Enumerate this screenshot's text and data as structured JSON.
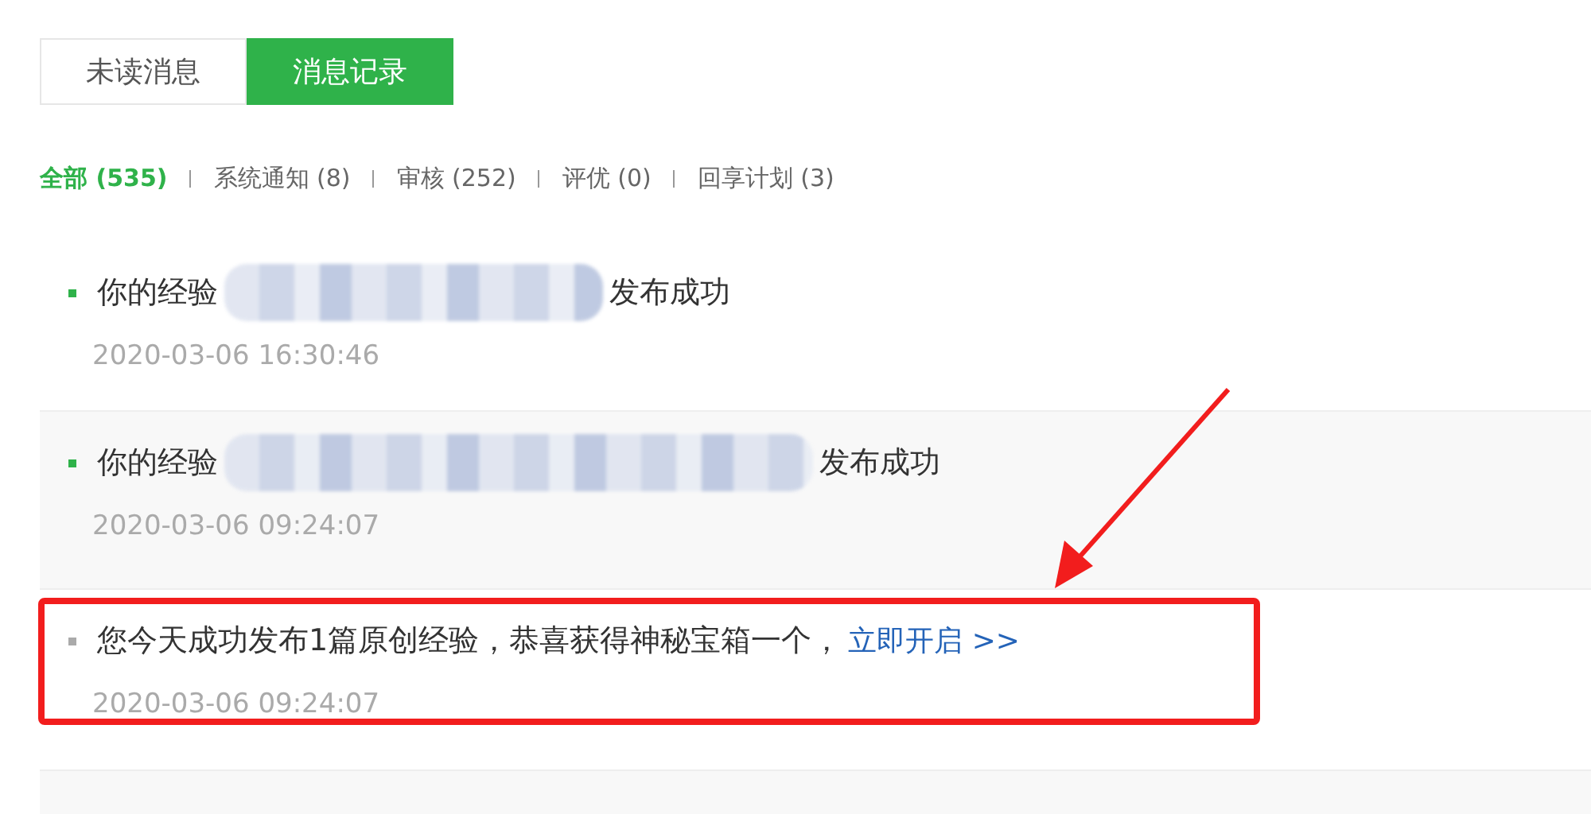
{
  "tabs": [
    {
      "label": "未读消息",
      "selected": false
    },
    {
      "label": "消息记录",
      "selected": true
    }
  ],
  "filters": [
    {
      "label": "全部 (535)",
      "selected": true
    },
    {
      "label": "系统通知 (8)",
      "selected": false
    },
    {
      "label": "审核 (252)",
      "selected": false
    },
    {
      "label": "评优 (0)",
      "selected": false
    },
    {
      "label": "回享计划 (3)",
      "selected": false
    }
  ],
  "messages": [
    {
      "kind": "shortblur",
      "unread": true,
      "highlighted": false,
      "text": "你的经验",
      "text_after": "发布成功",
      "time": "2020-03-06 16:30:46"
    },
    {
      "kind": "longblur",
      "unread": true,
      "highlighted": false,
      "text": "你的经验",
      "text_after": "发布成功",
      "time": "2020-03-06 09:24:07"
    },
    {
      "kind": "reward",
      "unread": false,
      "highlighted": true,
      "text": "您今天成功发布1篇原创经验，恭喜获得神秘宝箱一个，",
      "link": "立即开启 >>",
      "time": "2020-03-06 09:24:07"
    }
  ]
}
